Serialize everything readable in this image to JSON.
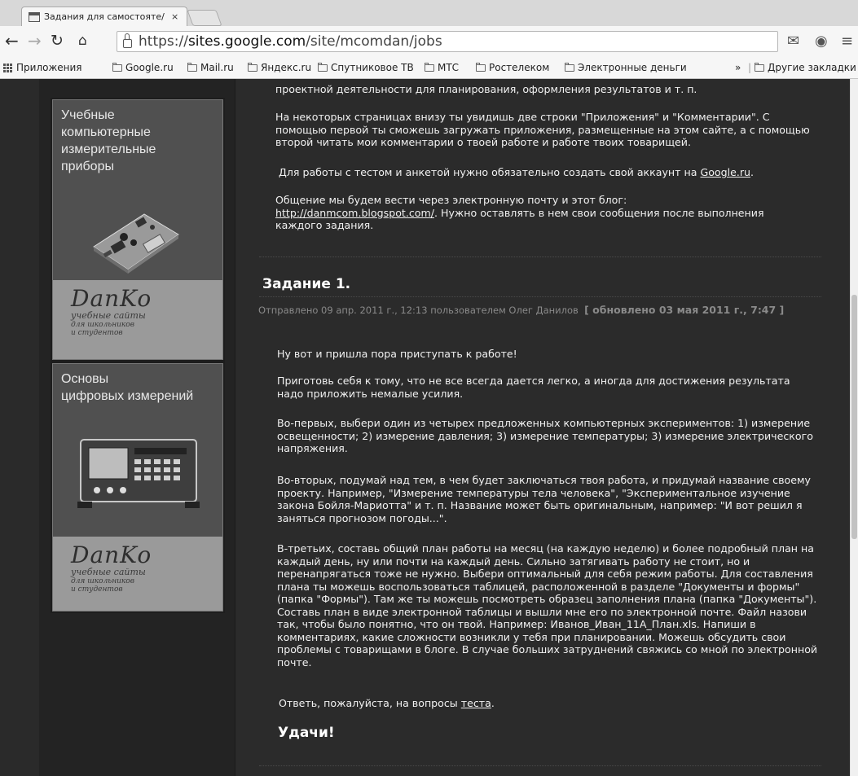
{
  "browser": {
    "tab_title": "Задания для самостояте/",
    "tab_close": "×",
    "url_scheme": "https://",
    "url_domain": "sites.google.com",
    "url_path": "/site/mcomdan/jobs",
    "bookmarks": [
      "Приложения",
      "Google.ru",
      "Mail.ru",
      "Яндекс.ru",
      "Спутниковое ТВ",
      "МТС",
      "Ростелеком",
      "Электронные деньги"
    ],
    "bookmarks_overflow": "»",
    "other_bookmarks": "Другие закладки"
  },
  "sidebar": {
    "banner1": {
      "title_lines": [
        "Учебные",
        "компьютерные",
        "измерительные",
        "приборы"
      ],
      "logo": "DanKo",
      "sub_lines": [
        "учебные сайты",
        "для школьников",
        "и студентов"
      ]
    },
    "banner2": {
      "title_lines": [
        "Основы",
        "цифровых измерений"
      ],
      "logo": "DanKo",
      "sub_lines": [
        "учебные сайты",
        "для школьников",
        "и студентов"
      ]
    }
  },
  "intro": {
    "p0": "проектной деятельности для планирования, оформления результатов и т. п.",
    "p1": "На некоторых страницах внизу ты увидишь две строки \"Приложения\" и \"Комментарии\". С помощью первой ты сможешь загружать приложения, размещенные на этом сайте, а с помощью второй читать мои комментарии о твоей работе и работе твоих товарищей.",
    "p2_text": "Для работы с тестом и анкетой нужно обязательно создать свой аккаунт на ",
    "p2_link": "Google.ru",
    "p2_end": ".",
    "p3_text": "Общение мы будем вести через электронную почту и этот блог: ",
    "p3_link": "http://danmcom.blogspot.com/",
    "p3_end": ". Нужно оставлять в нем свои сообщения после выполнения каждого задания."
  },
  "post": {
    "title": "Задание 1.",
    "meta": "Отправлено 09 апр. 2011 г., 12:13 пользователем Олег Данилов",
    "updated": "[ обновлено 03 мая 2011 г., 7:47 ]",
    "p1": "Ну вот и пришла пора приступать к работе!",
    "p2": "Приготовь себя к тому, что не все всегда дается легко, а иногда для достижения результата надо приложить немалые усилия.",
    "p3": "Во-первых, выбери один из четырех предложенных компьютерных экспериментов: 1) измерение освещенности; 2) измерение давления; 3) измерение температуры; 3) измерение электрического напряжения.",
    "p4": "Во-вторых, подумай над тем, в чем будет заключаться твоя работа, и придумай название своему проекту. Например, \"Измерение температуры тела человека\", \"Экспериментальное изучение закона Бойля-Мариотта\" и т. п. Название может быть оригинальным, например: \"И вот решил я заняться прогнозом погоды...\".",
    "p5": "В-третьих, составь общий план работы на месяц (на каждую неделю) и более подробный план на каждый день, ну или почти на каждый день. Сильно затягивать работу не стоит, но и перенапрягаться тоже не нужно. Выбери оптимальный для себя режим работы. Для составления плана ты можешь воспользоваться таблицей, расположенной в разделе \"Документы и формы\" (папка \"Формы\"). Там же ты можешь посмотреть образец заполнения плана (папка \"Документы\"). Составь план в виде электронной таблицы и вышли мне его по электронной почте. Файл назови так, чтобы было понятно, что он твой. Например: Иванов_Иван_11А_План.xls. Напиши в комментариях, какие сложности возникли у тебя при планировании. Можешь обсудить свои проблемы с товарищами в блоге. В случае больших затруднений свяжись со мной по электронной почте.",
    "p6_text": "Ответь, пожалуйста, на вопросы ",
    "p6_link": "теста",
    "p6_end": ".",
    "closing": "Удачи!"
  }
}
